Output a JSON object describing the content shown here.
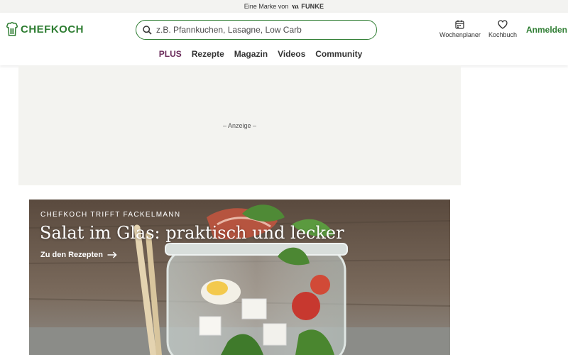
{
  "topstrip": {
    "text": "Eine Marke von",
    "brand": "FUNKE"
  },
  "header": {
    "logo_text": "CHEFKOCH",
    "search_placeholder": "z.B. Pfannkuchen, Lasagne, Low Carb",
    "actions": [
      {
        "label": "Wochenplaner",
        "icon": "calendar-icon"
      },
      {
        "label": "Kochbuch",
        "icon": "heart-icon"
      }
    ],
    "login_label": "Anmelden"
  },
  "nav": {
    "items": [
      "PLUS",
      "Rezepte",
      "Magazin",
      "Videos",
      "Community"
    ]
  },
  "ad": {
    "label": "– Anzeige –"
  },
  "hero": {
    "kicker": "CHEFKOCH TRIFFT FACKELMANN",
    "title": "Salat im Glas: praktisch und lecker",
    "link_label": "Zu den Rezepten"
  },
  "colors": {
    "brand_green": "#2e7d32",
    "plus_purple": "#6b2c5b"
  }
}
